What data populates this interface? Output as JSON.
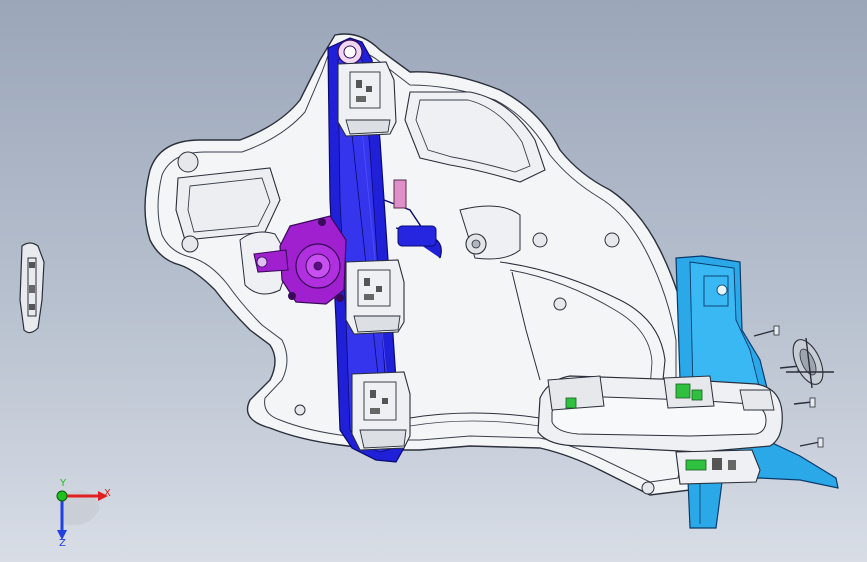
{
  "viewport": {
    "background_top": "#9ba6b9",
    "background_bottom": "#d8dde6"
  },
  "colors": {
    "panel_fill": "#f4f5f7",
    "panel_edge": "#2a2f3a",
    "regulator_rail": "#2020d8",
    "motor_purple": "#a020d0",
    "bracket_blue": "#2aa8e8",
    "handle_white": "#eef0f3",
    "clip_green": "#30c040",
    "connector_pink": "#e090c8"
  },
  "axis_triad": {
    "x_label": "X",
    "y_label": "Y",
    "z_label": "Z",
    "x_color": "#e02020",
    "y_color": "#20c020",
    "z_color": "#2040e0"
  },
  "icons": {
    "triad": "axis-triad-icon"
  }
}
